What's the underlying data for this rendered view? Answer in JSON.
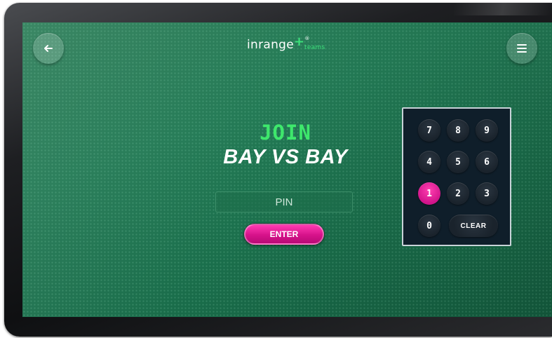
{
  "header": {
    "logo_main": "inrange",
    "logo_plus": "+",
    "logo_reg": "®",
    "logo_sub": "teams",
    "back_icon": "arrow-left-icon",
    "menu_icon": "hamburger-menu-icon"
  },
  "main": {
    "join_label": "JOIN",
    "event_name": "BAY VS BAY",
    "pin_placeholder": "PIN",
    "pin_value": "",
    "enter_label": "ENTER"
  },
  "keypad": {
    "keys": [
      "7",
      "8",
      "9",
      "4",
      "5",
      "6",
      "1",
      "2",
      "3",
      "0"
    ],
    "clear_label": "CLEAR",
    "active_key": "1"
  },
  "colors": {
    "accent_green": "#3ee86c",
    "accent_pink": "#d6128a",
    "background": "#1f7350",
    "keypad_bg": "#0f1e2a"
  }
}
